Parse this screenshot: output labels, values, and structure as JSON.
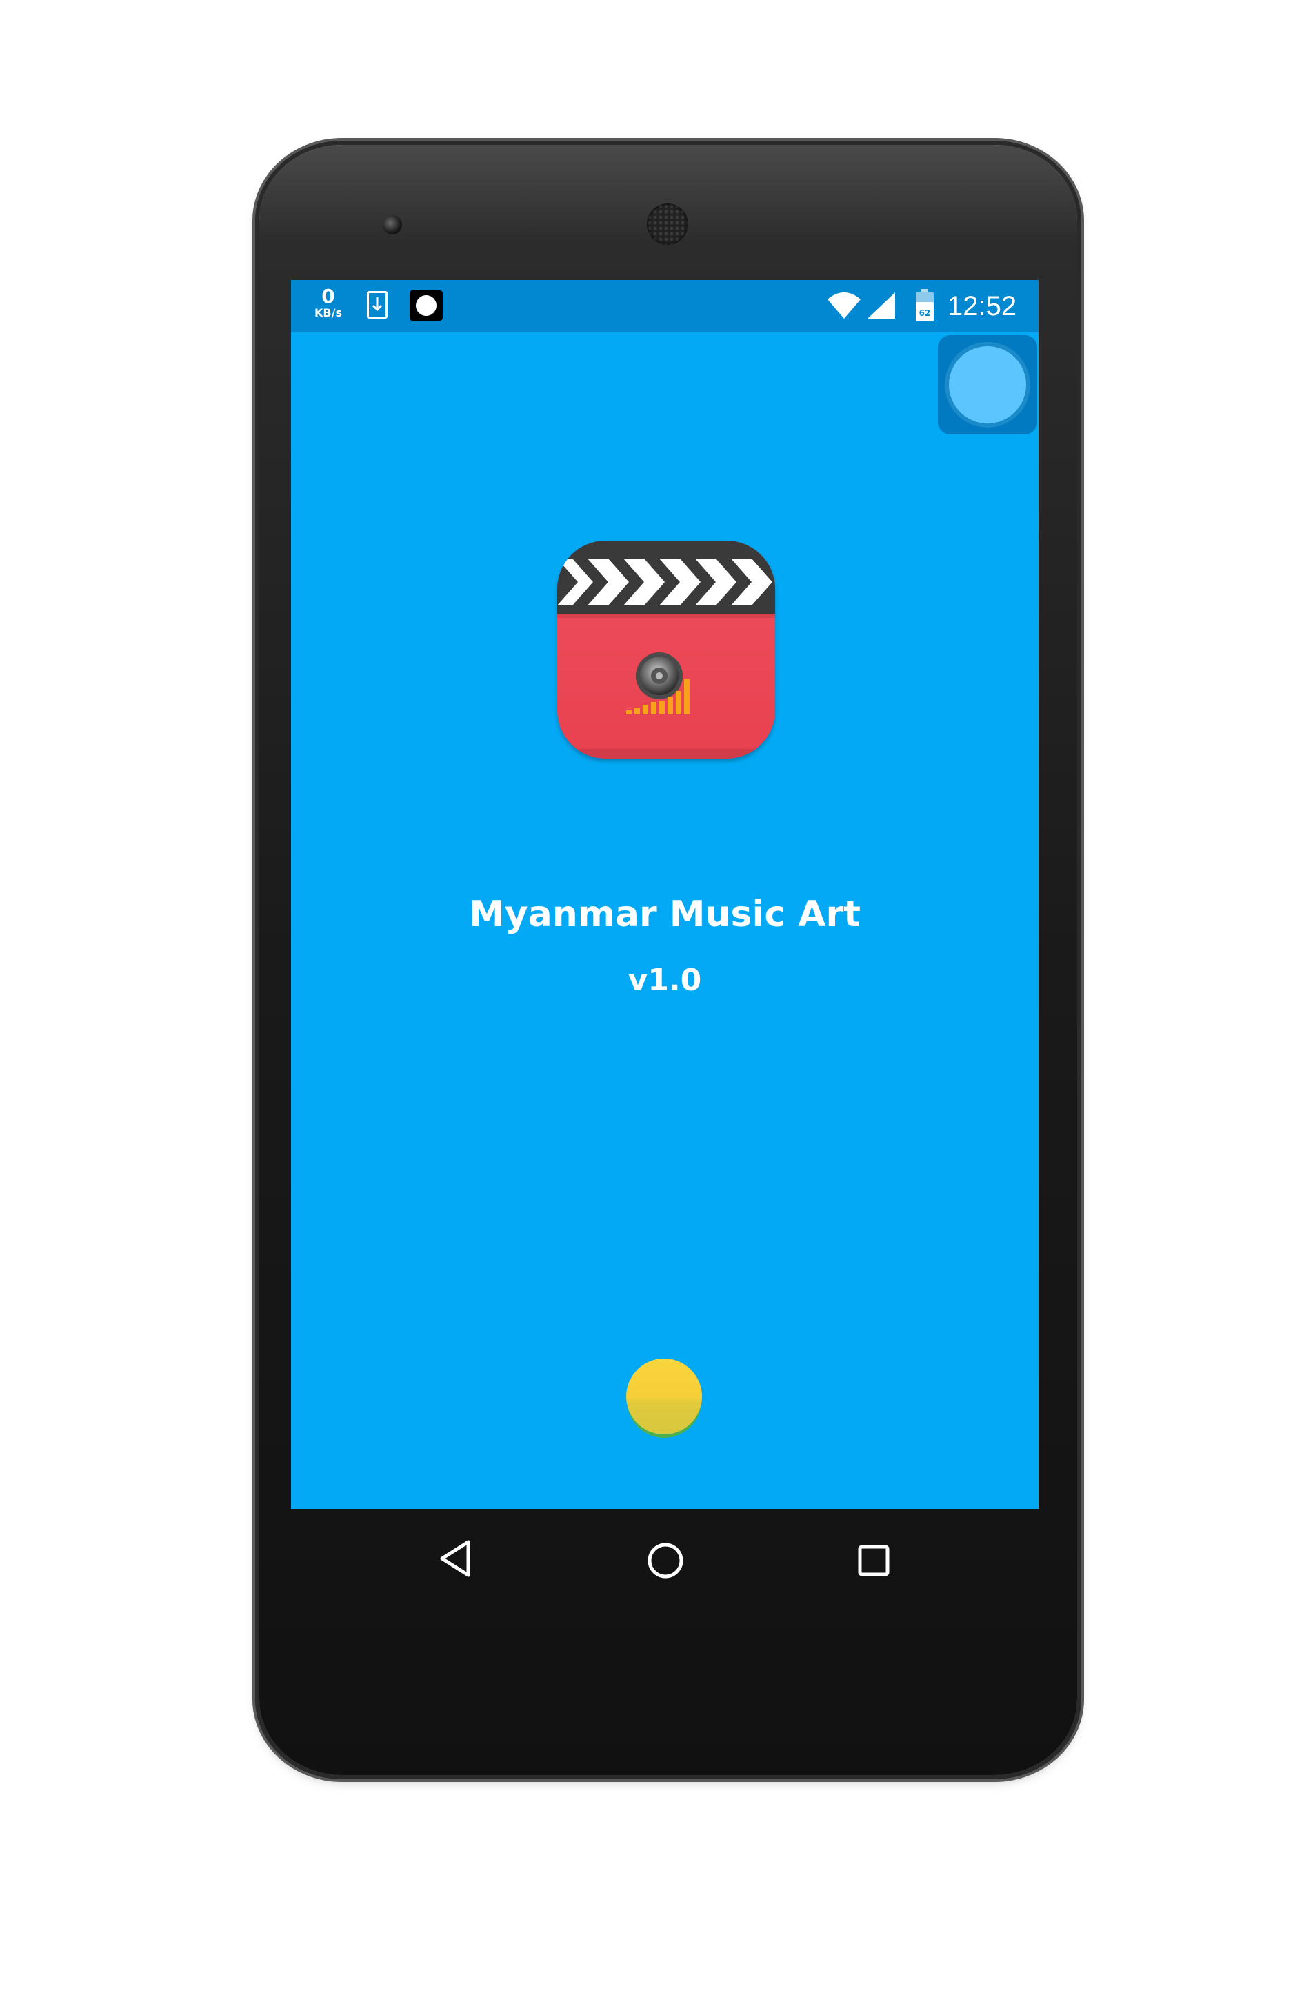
{
  "status_bar": {
    "net_speed_value": "0",
    "net_speed_unit": "KB/s",
    "battery_level": "62",
    "time": "12:52"
  },
  "app": {
    "title": "Myanmar Music Art",
    "version": "v1.0"
  },
  "icons": {
    "download": "download-icon",
    "record": "screen-record-icon",
    "wifi": "wifi-icon",
    "signal": "cell-signal-icon",
    "battery": "battery-icon",
    "assistive_touch": "assistive-touch-icon",
    "app_icon": "clapperboard-speaker-icon",
    "back": "back-icon",
    "home": "home-icon",
    "recent": "recent-apps-icon"
  },
  "colors": {
    "screen_bg": "#03a9f4",
    "status_bar_bg": "#0288d1",
    "icon_red": "#ed4a5a",
    "loader_yellow": "#f9d53d"
  }
}
